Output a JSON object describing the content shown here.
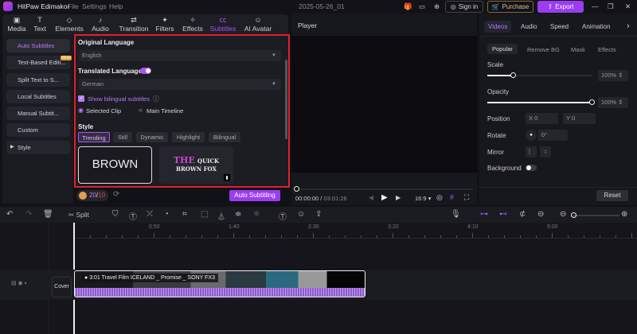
{
  "app": {
    "title": "HitPaw Edimakor",
    "menus": [
      "File",
      "Settings",
      "Help"
    ],
    "project": "2025-05-26_01",
    "sign_in": "Sign in",
    "purchase": "Purchase",
    "export": "Export"
  },
  "toolbar": [
    {
      "label": "Media",
      "icon": "media-icon"
    },
    {
      "label": "Text",
      "icon": "text-icon"
    },
    {
      "label": "Elements",
      "icon": "elements-icon"
    },
    {
      "label": "Audio",
      "icon": "audio-icon"
    },
    {
      "label": "Transition",
      "icon": "transition-icon"
    },
    {
      "label": "Filters",
      "icon": "filters-icon"
    },
    {
      "label": "Effects",
      "icon": "effects-icon"
    },
    {
      "label": "Subtitles",
      "icon": "subtitles-icon",
      "active": true
    },
    {
      "label": "AI Avatar",
      "icon": "ai-avatar-icon"
    }
  ],
  "sidebar": {
    "items": [
      "Auto Subtitles",
      "Text-Based Editi...",
      "Split Text to S...",
      "Local Subtitles",
      "Manual Subtit...",
      "Custom",
      "Style"
    ],
    "new_badge": "NEW"
  },
  "subtitles": {
    "original_language_label": "Original Language",
    "original_language": "English",
    "translated_language_label": "Translated Language",
    "translated_language": "German",
    "translate_on": true,
    "show_bilingual_label": "Show bilingual subtitles",
    "show_bilingual": true,
    "scope_options": [
      "Selected Clip",
      "Main Timeline"
    ],
    "scope_selected": "Selected Clip",
    "style_label": "Style",
    "style_tabs": [
      "Trending",
      "Still",
      "Dynamic",
      "Highlight",
      "Bilingual"
    ],
    "style_active": "Trending",
    "preset1": "BROWN",
    "preset2_line1_a": "THE",
    "preset2_line1_b": "QUICK",
    "preset2_line2": "BROWN FOX",
    "credits_used": "20",
    "credits_total": "10",
    "auto_button": "Auto Subtitling"
  },
  "player": {
    "title": "Player",
    "time_current": "00:00:00",
    "time_total": "03:01:26",
    "aspect": "16:9",
    "progress": 0
  },
  "right": {
    "tabs": [
      "Videos",
      "Audio",
      "Speed",
      "Animation"
    ],
    "active_tab": "Videos",
    "subtabs": [
      "Popular",
      "Remove BG",
      "Mask",
      "Effects"
    ],
    "scale_label": "Scale",
    "scale": "100%",
    "scale_fraction": 0.25,
    "opacity_label": "Opacity",
    "opacity": "100%",
    "opacity_fraction": 1.0,
    "position_label": "Position",
    "x_label": "X",
    "x": "0",
    "y_label": "Y",
    "y": "0",
    "rotate_label": "Rotate",
    "rotate": "0°",
    "mirror_label": "Mirror",
    "background_label": "Background",
    "background_on": false,
    "reset": "Reset"
  },
  "timeline": {
    "split": "Split",
    "ruler": [
      "0:50",
      "1:40",
      "2:30",
      "3:20",
      "4:10",
      "5:00"
    ],
    "cover": "Cover",
    "clip_title": "3:01 Travel Film ICELAND _ Promise _ SONY FX3"
  },
  "colors": {
    "accent": "#a855f7",
    "highlight_border": "#e0202a",
    "export": "#9b3cf0"
  }
}
